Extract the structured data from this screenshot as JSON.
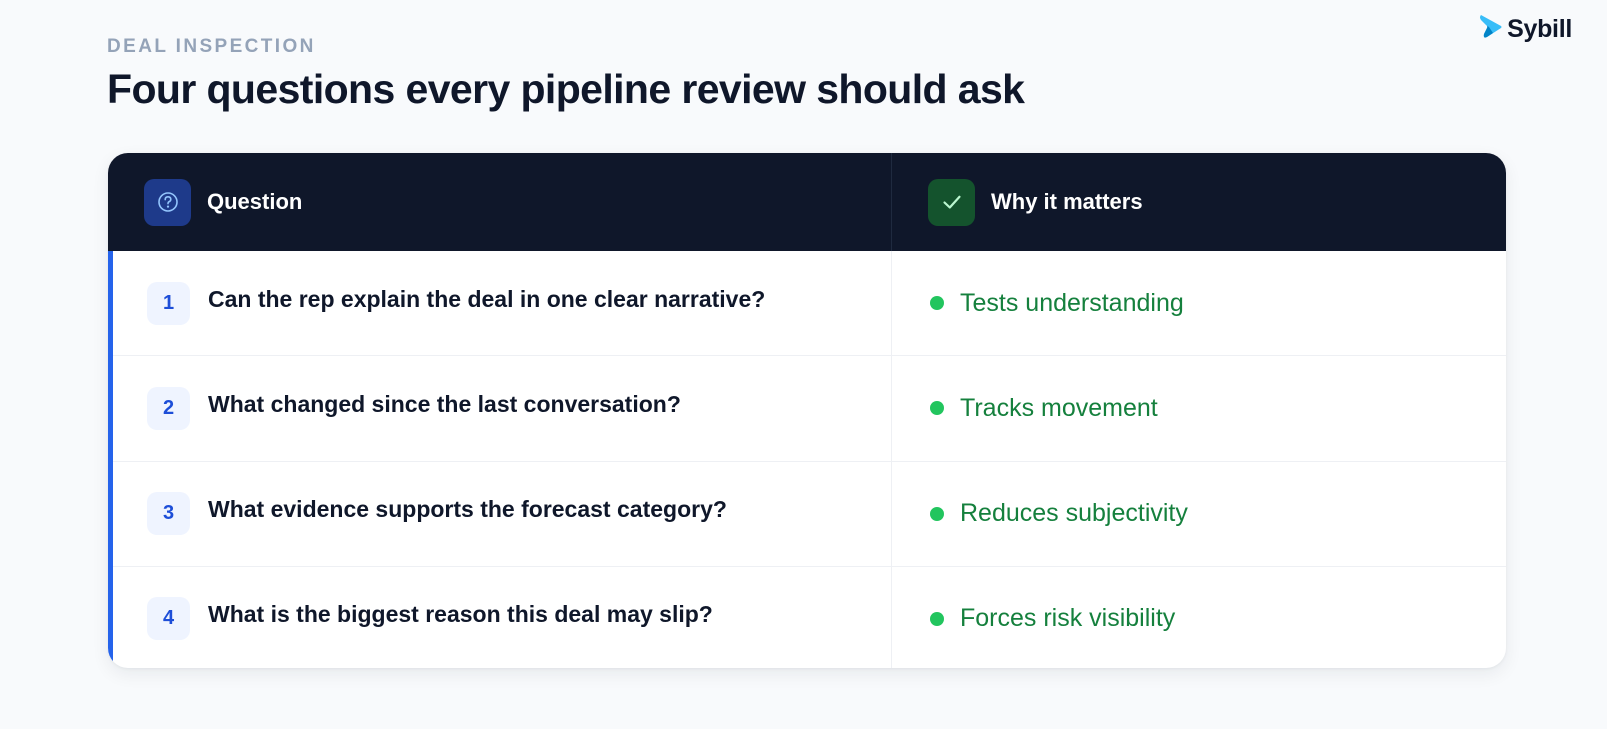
{
  "brand": {
    "name": "Sybill"
  },
  "header": {
    "eyebrow": "DEAL INSPECTION",
    "title": "Four questions every pipeline review should ask"
  },
  "table": {
    "columns": {
      "question": {
        "label": "Question",
        "icon": "question-circle-icon"
      },
      "why": {
        "label": "Why it matters",
        "icon": "check-icon"
      }
    },
    "rows": [
      {
        "number": "1",
        "question": "Can the rep explain the deal in one clear narrative?",
        "why": "Tests understanding"
      },
      {
        "number": "2",
        "question": "What changed since the last conversation?",
        "why": "Tracks movement"
      },
      {
        "number": "3",
        "question": "What evidence supports the forecast category?",
        "why": "Reduces subjectivity"
      },
      {
        "number": "4",
        "question": "What is the biggest reason this deal may slip?",
        "why": "Forces risk visibility"
      }
    ]
  },
  "colors": {
    "header_bg": "#0f172a",
    "accent": "#2563eb",
    "positive": "#15803d",
    "dot": "#22c55e"
  }
}
